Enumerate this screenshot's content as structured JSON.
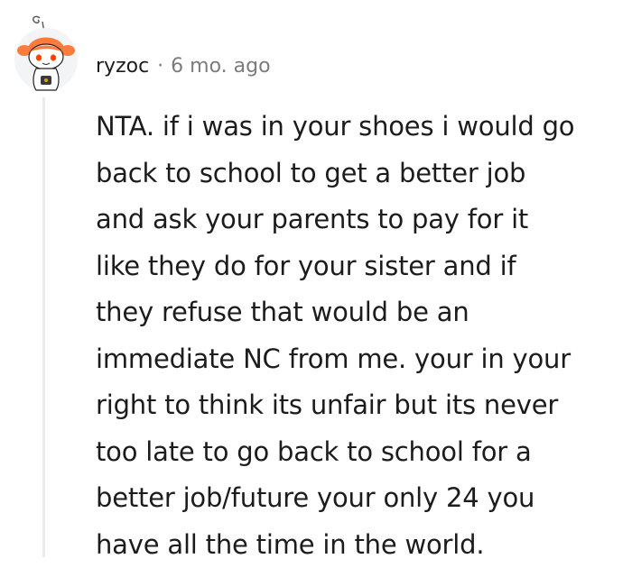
{
  "comment": {
    "author": "ryzoc",
    "separator": "·",
    "timestamp": "6 mo. ago",
    "body_lines": [
      "NTA. if i was in your shoes i would go",
      "back to school to get a better job",
      "and ask your parents to pay for it",
      "like they do for your sister and if",
      "they refuse that would be an",
      "immediate NC from me. your in your",
      "right to think its unfair but its never",
      "too late to go back to school for a",
      "better job/future your only 24 you",
      "have all the time in the world."
    ]
  },
  "avatar": {
    "icon": "snoo-avatar-icon",
    "colors": {
      "background": "#f2f4f5",
      "hair": "#ff7a3d",
      "body": "#ffffff",
      "eyes": "#ff4500",
      "shirt": "#3a3a3a"
    }
  },
  "colors": {
    "text": "#1c1c1c",
    "meta": "#7c7c7c",
    "thread_line": "#e7ebee"
  }
}
